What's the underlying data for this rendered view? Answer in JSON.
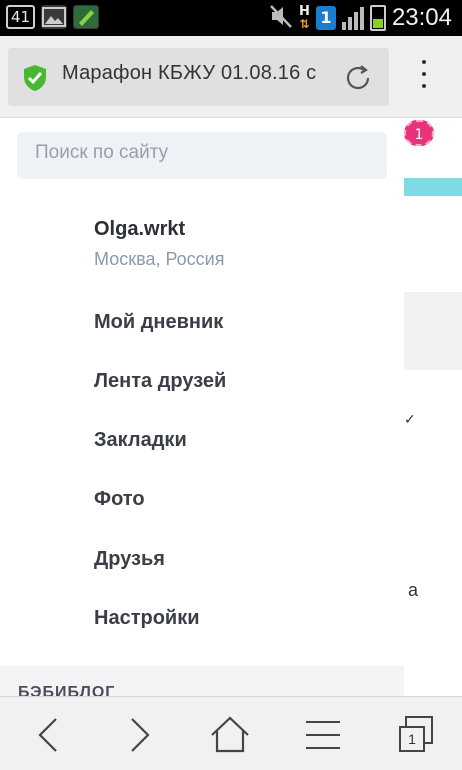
{
  "statusbar": {
    "notification_count": "41",
    "network_badge": "1",
    "network_type": "H",
    "clock": "23:04"
  },
  "browser": {
    "url_title": "Марафон КБЖУ 01.08.16 с",
    "secure_icon": "shield-check-icon",
    "reload_icon": "reload-icon",
    "menu_icon": "overflow-menu-icon",
    "accent_green": "#47b832"
  },
  "drawer": {
    "search_placeholder": "Поиск по сайту",
    "user": {
      "name": "Olga.wrkt",
      "location": "Москва, Россия"
    },
    "nav": [
      {
        "label": "Мой дневник"
      },
      {
        "label": "Лента друзей"
      },
      {
        "label": "Закладки"
      },
      {
        "label": "Фото"
      },
      {
        "label": "Друзья"
      },
      {
        "label": "Настройки"
      }
    ],
    "section_title": "БЭБИБЛОГ"
  },
  "background_page": {
    "badge": "1",
    "badge_color": "#e8337a",
    "check": "✓",
    "letter": "а"
  },
  "bottom_nav": {
    "back_icon": "chevron-left-icon",
    "forward_icon": "chevron-right-icon",
    "home_icon": "home-icon",
    "menu_icon": "hamburger-icon",
    "tabs_icon": "tabs-icon",
    "tabs_count": "1"
  }
}
